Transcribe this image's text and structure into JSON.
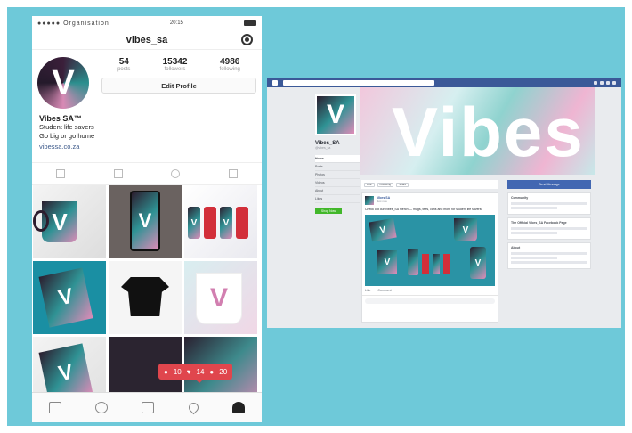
{
  "instagram": {
    "status": {
      "carrier": "●●●●● Organisation",
      "time": "20:15"
    },
    "username": "vibes_sa",
    "stats": [
      {
        "value": "54",
        "label": "posts"
      },
      {
        "value": "15342",
        "label": "followers"
      },
      {
        "value": "4986",
        "label": "following"
      }
    ],
    "edit_profile_label": "Edit Profile",
    "avatar_letter": "V",
    "bio": {
      "name": "Vibes SA™",
      "line1": "Student life savers",
      "line2": "Go big or go home",
      "link": "vibessa.co.za"
    },
    "tile_letter": "V",
    "notification": {
      "comments": "10",
      "likes": "14",
      "followers": "20"
    }
  },
  "facebook": {
    "cover_title": "Vibes",
    "page_name": "Vibes_SA",
    "page_handle": "@vibes_sa",
    "pic_letter": "V",
    "nav_links": [
      "Home",
      "Posts",
      "Photos",
      "Videos",
      "About",
      "Likes"
    ],
    "shop_label": "Shop Now",
    "actions": [
      "Like",
      "Following",
      "Share"
    ],
    "message_label": "Send Message",
    "post": {
      "name": "Vibes SA",
      "meta": "Just now",
      "text": "Check out our Vibes_SA merch — mugs, tees, cans and more for student life savers!",
      "like_label": "Like",
      "comment_label": "Comment"
    },
    "right_boxes": [
      {
        "title": "Community"
      },
      {
        "title": "The Official Vibes_SA Facebook Page"
      },
      {
        "title": "About"
      }
    ]
  },
  "colors": {
    "background": "#6ec9d9",
    "facebook_bar": "#3b5998",
    "notification": "#e0464d",
    "brand_teal": "#2f9294",
    "brand_pink": "#e08bb8"
  }
}
